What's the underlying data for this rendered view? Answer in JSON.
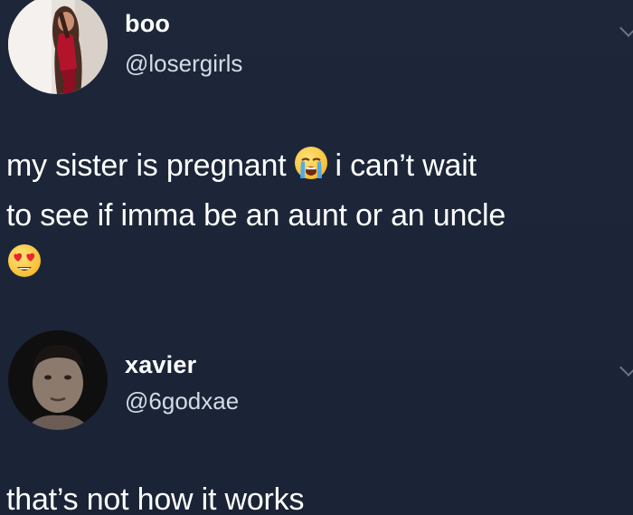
{
  "tweets": [
    {
      "display_name": "boo",
      "handle": "@losergirls",
      "text_parts": [
        "my sister is pregnant",
        "i can’t wait",
        "to see if imma be an aunt or an uncle"
      ],
      "emojis": [
        "loudly-crying-face-icon",
        "smiling-face-with-heart-eyes-icon"
      ]
    },
    {
      "display_name": "xavier",
      "handle": "@6godxae",
      "text": "that’s not how it works"
    }
  ],
  "colors": {
    "background": "#1c2638",
    "text": "#ffffff",
    "handle": "#d4dbe6",
    "chevron": "#7d8aa0"
  }
}
